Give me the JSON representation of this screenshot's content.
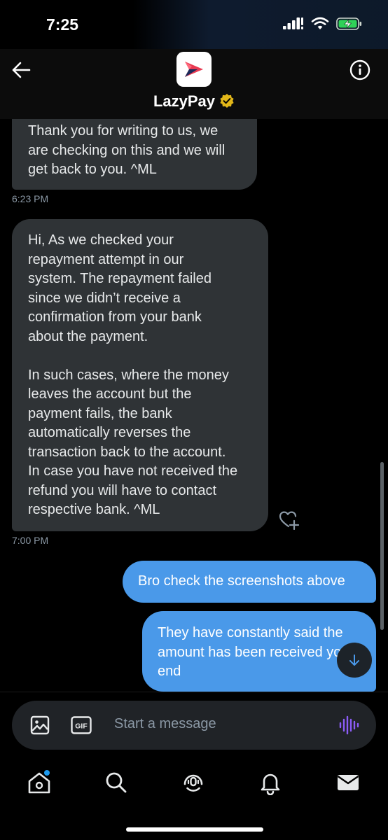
{
  "status_bar": {
    "time": "7:25"
  },
  "header": {
    "contact_name": "LazyPay",
    "back_icon": "arrow-left-icon",
    "info_icon": "info-circle-icon",
    "verified_icon": "gold-verified-badge-icon",
    "brand_color": "#e83a52"
  },
  "messages": [
    {
      "direction": "incoming",
      "text": "Thank you for writing to us, we\nare checking on this and we will\nget back to you. ^ML",
      "time": "6:23 PM"
    },
    {
      "direction": "incoming",
      "text": "Hi, As we checked your\nrepayment attempt in our\nsystem. The repayment failed\nsince we didn’t receive a\nconfirmation from your bank\nabout the payment.\n\nIn such cases, where the money\nleaves the account but the\npayment fails, the bank\nautomatically reverses the\ntransaction back to the account.\nIn case you have not received the\nrefund you will have to contact\nrespective bank. ^ML",
      "time": "7:00 PM"
    },
    {
      "direction": "outgoing",
      "text": "Bro check the screenshots above"
    },
    {
      "direction": "outgoing",
      "text": "They have constantly said the amount has been received your end"
    }
  ],
  "composer": {
    "placeholder": "Start a message",
    "media_icon": "image-icon",
    "gif_label": "GIF",
    "voice_icon": "voice-waveform-icon"
  },
  "tabs": [
    {
      "name": "home",
      "icon": "home-icon",
      "has_notification_dot": true
    },
    {
      "name": "search",
      "icon": "search-icon"
    },
    {
      "name": "spaces",
      "icon": "spaces-icon"
    },
    {
      "name": "notifications",
      "icon": "bell-icon"
    },
    {
      "name": "messages",
      "icon": "mail-icon"
    }
  ],
  "colors": {
    "background": "#000000",
    "incoming_bubble": "#2f3336",
    "outgoing_bubble": "#4a99e9",
    "secondary_text": "#8b98a5",
    "accent": "#1d9bf0",
    "voice_accent": "#8b5cf6"
  }
}
